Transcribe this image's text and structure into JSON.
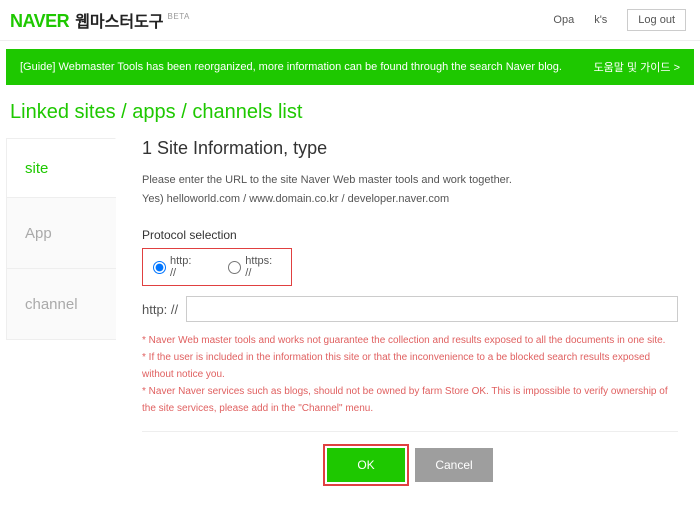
{
  "header": {
    "logo": "NAVER",
    "logo_sub": "웹마스터도구",
    "beta": "BETA",
    "link1": "Opa",
    "link2": "k's",
    "logout": "Log out"
  },
  "notice": {
    "text": "[Guide] Webmaster Tools has been reorganized, more information can be found through the search Naver blog.",
    "help": "도움말 및 가이드 >"
  },
  "page_title": "Linked sites / apps / channels list",
  "sidebar": {
    "items": [
      {
        "label": "site"
      },
      {
        "label": "App"
      },
      {
        "label": "channel"
      }
    ]
  },
  "main": {
    "heading": "1 Site Information, type",
    "desc_line1": "Please enter the URL to the site Naver Web master tools and work together.",
    "desc_line2": "Yes) helloworld.com / www.domain.co.kr / developer.naver.com",
    "protocol_label": "Protocol selection",
    "protocol_opts": {
      "http": "http: //",
      "https": "https: //"
    },
    "url_prefix": "http: //",
    "url_value": "",
    "warnings": {
      "w1": "* Naver Web master tools and works not guarantee the collection and results exposed to all the documents in one site.",
      "w2": "* If the user is included in the information this site or that the inconvenience to a be blocked search results exposed without notice you.",
      "w3": "* Naver Naver services such as blogs, should not be owned by farm Store OK. This is impossible to verify ownership of the site services, please add in the \"Channel\" menu."
    },
    "buttons": {
      "ok": "OK",
      "cancel": "Cancel"
    }
  }
}
